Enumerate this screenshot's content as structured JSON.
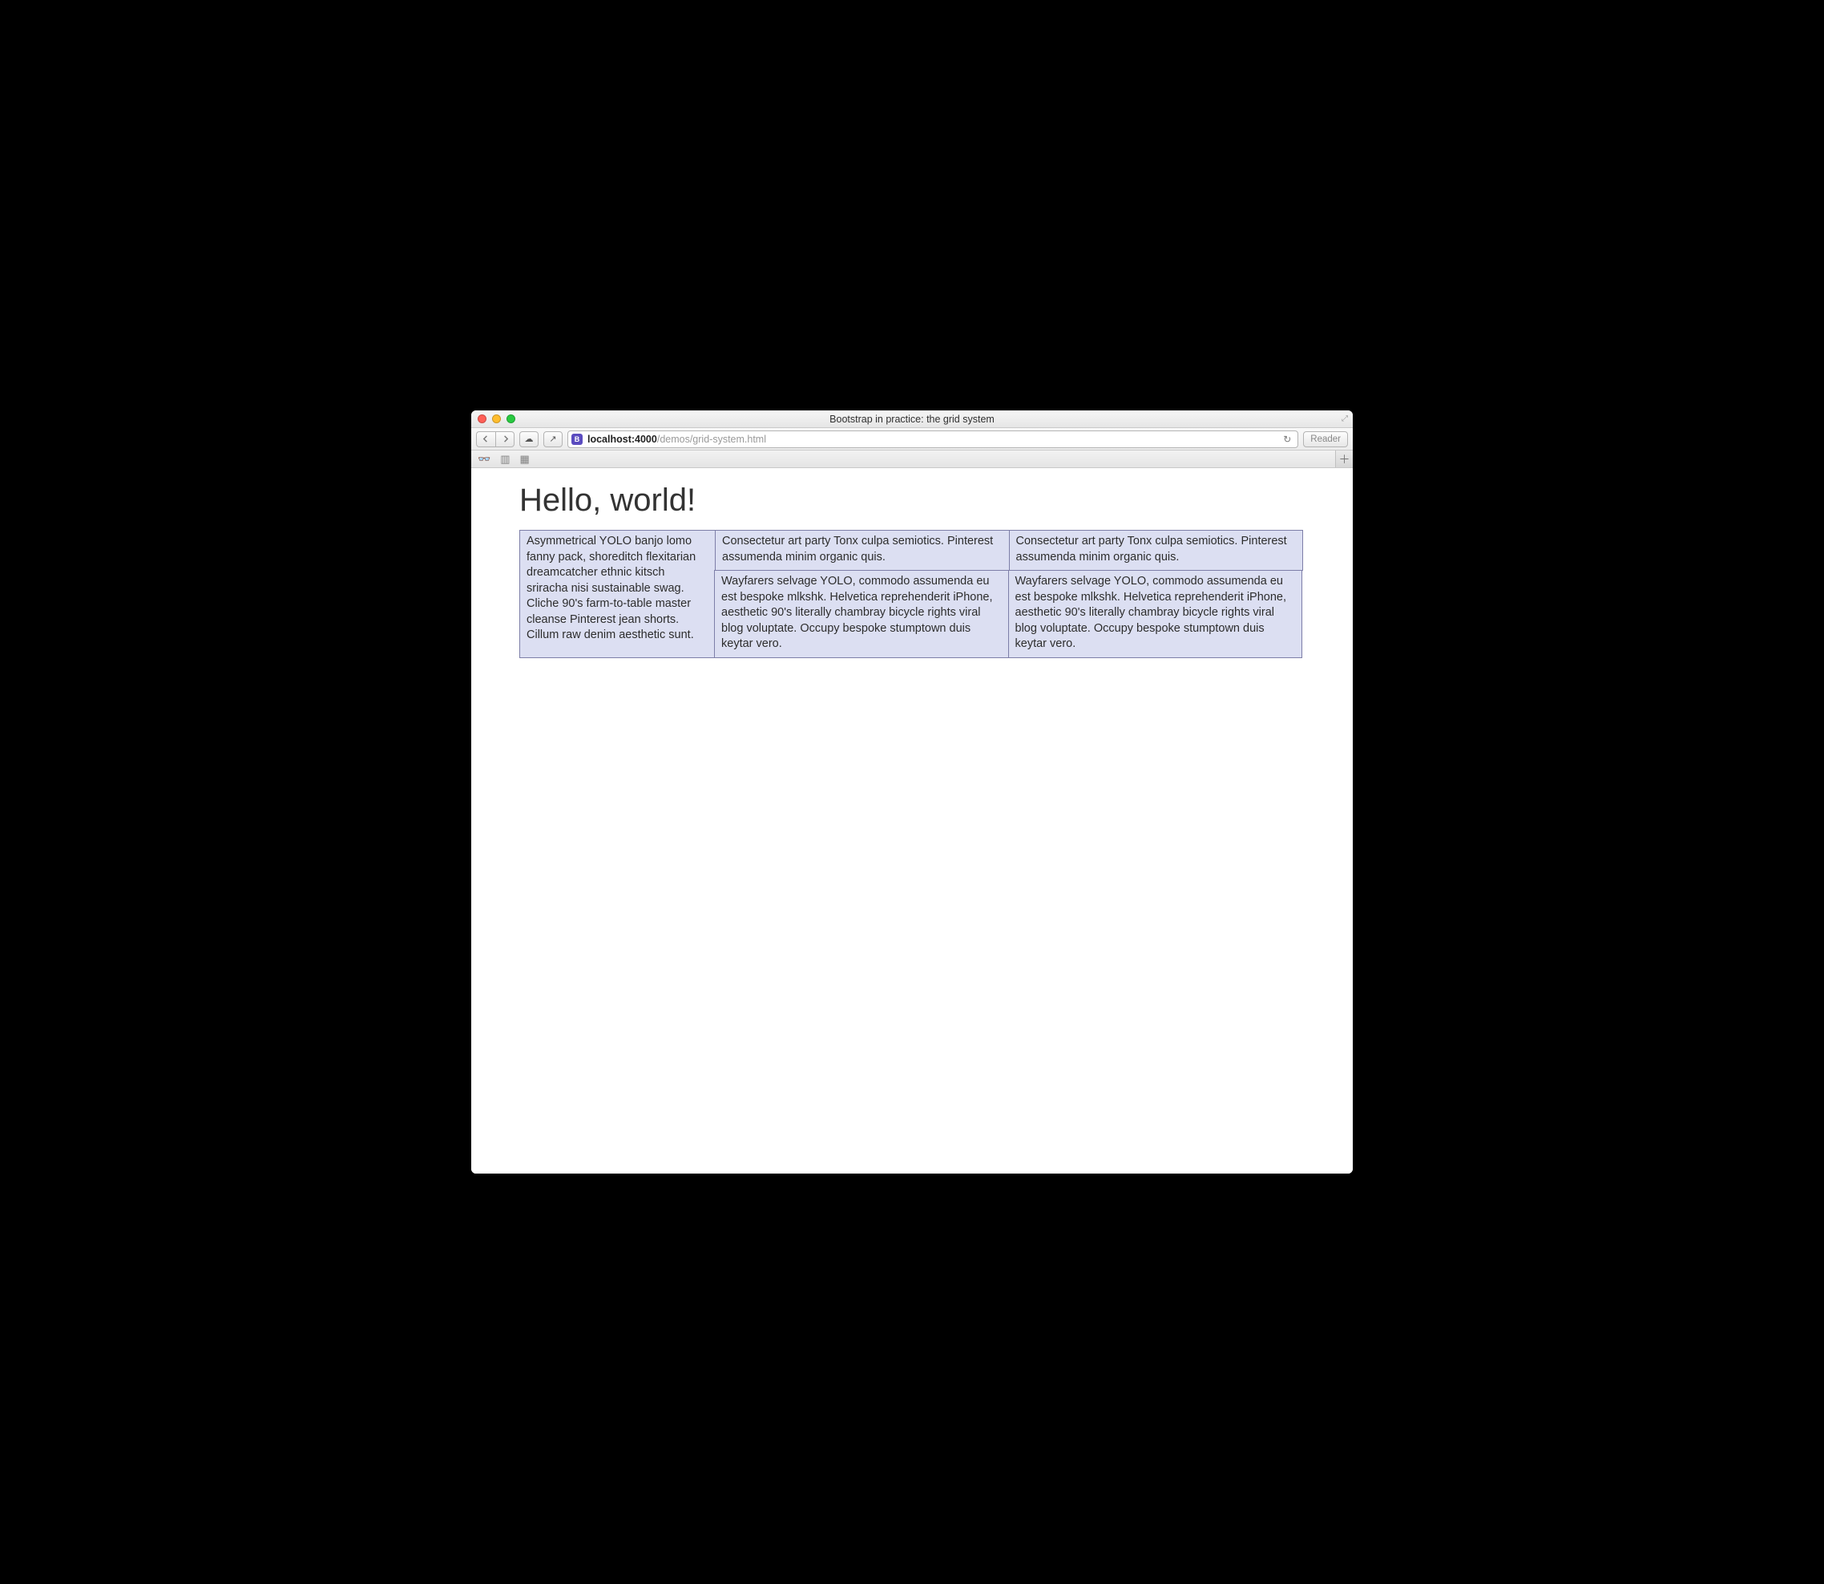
{
  "window": {
    "title": "Bootstrap in practice: the grid system"
  },
  "toolbar": {
    "address_host": "localhost:4000",
    "address_path": "/demos/grid-system.html",
    "reader_label": "Reader"
  },
  "page": {
    "heading": "Hello, world!",
    "col_left": "Asymmetrical YOLO banjo lomo fanny pack, shoreditch flexitarian dreamcatcher ethnic kitsch sriracha nisi sustainable swag. Cliche 90's farm-to-table master cleanse Pinterest jean shorts. Cillum raw denim aesthetic sunt.",
    "col_mid_top": "Consectetur art party Tonx culpa semiotics. Pinterest assumenda minim organic quis.",
    "col_mid_bottom": "Wayfarers selvage YOLO, commodo assumenda eu est bespoke mlkshk. Helvetica reprehenderit iPhone, aesthetic 90's literally chambray bicycle rights viral blog voluptate. Occupy bespoke stumptown duis keytar vero.",
    "col_right_top": "Consectetur art party Tonx culpa semiotics. Pinterest assumenda minim organic quis.",
    "col_right_bottom": "Wayfarers selvage YOLO, commodo assumenda eu est bespoke mlkshk. Helvetica reprehenderit iPhone, aesthetic 90's literally chambray bicycle rights viral blog voluptate. Occupy bespoke stumptown duis keytar vero."
  }
}
